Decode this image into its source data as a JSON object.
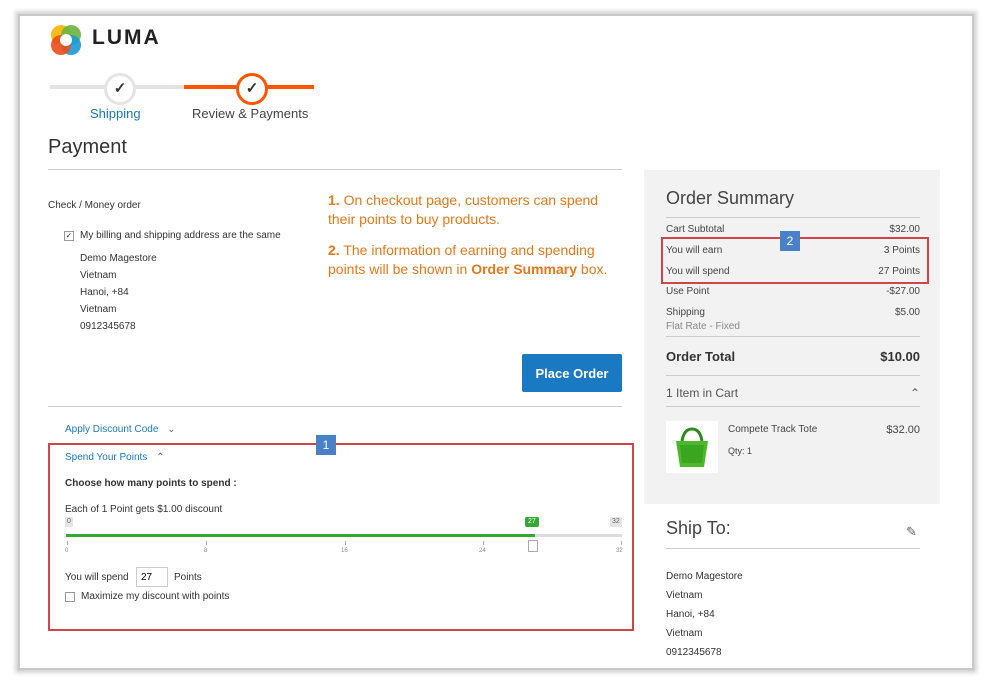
{
  "brand": {
    "name": "LUMA"
  },
  "progress": {
    "steps": [
      {
        "label": "Shipping",
        "icon": "check-icon"
      },
      {
        "label": "Review & Payments",
        "icon": "check-icon"
      }
    ]
  },
  "payment": {
    "title": "Payment",
    "method": "Check / Money order",
    "same_address_label": "My billing and shipping address are the same",
    "address": [
      "Demo Magestore",
      "Vietnam",
      "Hanoi, +84",
      "Vietnam",
      "0912345678"
    ],
    "place_order_label": "Place Order"
  },
  "callout": {
    "p1_num": "1.",
    "p1_text": " On checkout page, customers can spend their points to buy products.",
    "p2_num": "2.",
    "p2_text_a": " The information of earning and spending points will be shown in ",
    "p2_bold": "Order Summary",
    "p2_text_b": " box."
  },
  "discount": {
    "label": "Apply Discount Code",
    "icon": "chevron-down-icon"
  },
  "points": {
    "badge": "1",
    "title": "Spend Your Points",
    "icon": "chevron-up-icon",
    "choose_label": "Choose how many points to spend :",
    "rate_label": "Each of 1 Point gets $1.00 discount",
    "slider": {
      "min": "0",
      "max": "32",
      "value": "27",
      "ticks": [
        "0",
        "8",
        "16",
        "24",
        "32"
      ]
    },
    "spend_prefix": "You will spend",
    "spend_value": "27",
    "spend_suffix": "Points",
    "maximize_label": "Maximize my discount with points"
  },
  "summary": {
    "badge": "2",
    "title": "Order Summary",
    "rows": [
      {
        "label": "Cart Subtotal",
        "value": "$32.00"
      },
      {
        "label": "You will earn",
        "value": "3 Points"
      },
      {
        "label": "You will spend",
        "value": "27 Points"
      },
      {
        "label": "Use Point",
        "value": "-$27.00"
      },
      {
        "label": "Shipping",
        "sub": "Flat Rate - Fixed",
        "value": "$5.00"
      }
    ],
    "total_label": "Order Total",
    "total_value": "$10.00",
    "items_label": "1 Item in Cart",
    "item": {
      "name": "Compete Track Tote",
      "qty": "Qty: 1",
      "price": "$32.00"
    }
  },
  "ship_to": {
    "title": "Ship To:",
    "address": [
      "Demo Magestore",
      "Vietnam",
      "Hanoi, +84",
      "Vietnam",
      "0912345678"
    ]
  },
  "colors": {
    "accent": "#ff5501",
    "link": "#1979c3",
    "callout": "#e8781a",
    "highlight": "#d0444a",
    "badge": "#4a80c8",
    "slider": "#33a834"
  }
}
